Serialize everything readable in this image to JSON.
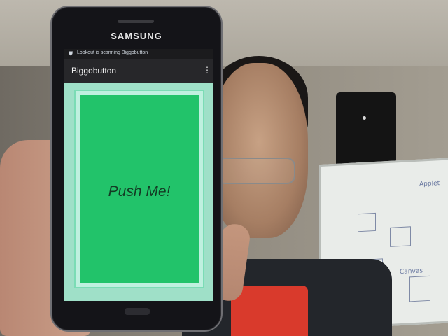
{
  "phone": {
    "brand": "SAMSUNG",
    "status_text": "Lookout is scanning Biggobutton",
    "app_title": "Biggobutton",
    "overflow_icon": "three-dots-vertical",
    "button_label": "Push Me!"
  },
  "colors": {
    "button_green": "#22C36A",
    "button_border": "#7BDCB5",
    "screen_dark": "#1F1F22",
    "shirt_red": "#D93A2C"
  },
  "whiteboard": {
    "annotations": [
      "Applet",
      "Canvas"
    ]
  }
}
